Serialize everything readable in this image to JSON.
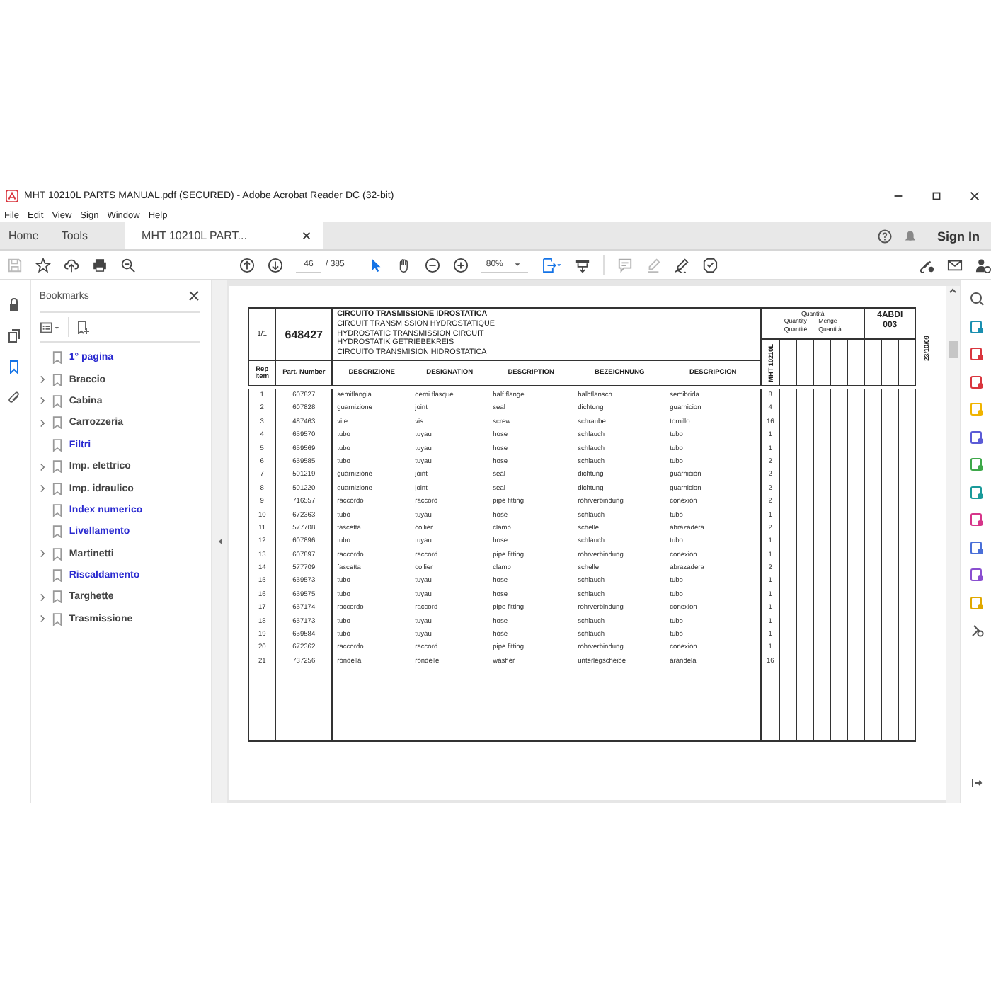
{
  "window": {
    "title": "MHT 10210L PARTS MANUAL.pdf (SECURED) - Adobe Acrobat Reader DC (32-bit)"
  },
  "menu": [
    "File",
    "Edit",
    "View",
    "Sign",
    "Window",
    "Help"
  ],
  "tabs": [
    {
      "label": "Home",
      "selected": false,
      "closable": false
    },
    {
      "label": "Tools",
      "selected": false,
      "closable": false
    },
    {
      "label": "MHT 10210L PART...",
      "selected": true,
      "closable": true
    }
  ],
  "sign_in": "Sign In",
  "toolbar": {
    "page": "46",
    "page_count": "/ 385",
    "zoom": "80%"
  },
  "bookmarks": {
    "title": "Bookmarks",
    "items": [
      {
        "label": "1° pagina",
        "has_children": false
      },
      {
        "label": "Braccio",
        "has_children": true
      },
      {
        "label": "Cabina",
        "has_children": true
      },
      {
        "label": "Carrozzeria",
        "has_children": true
      },
      {
        "label": "Filtri",
        "has_children": false
      },
      {
        "label": "Imp. elettrico",
        "has_children": true
      },
      {
        "label": "Imp. idraulico",
        "has_children": true
      },
      {
        "label": "Index numerico",
        "has_children": false
      },
      {
        "label": "Livellamento",
        "has_children": false
      },
      {
        "label": "Martinetti",
        "has_children": true
      },
      {
        "label": "Riscaldamento",
        "has_children": false
      },
      {
        "label": "Targhette",
        "has_children": true
      },
      {
        "label": "Trasmissione",
        "has_children": true
      }
    ]
  },
  "document": {
    "sheet": "1/1",
    "group_number": "648427",
    "titles": [
      "CIRCUITO TRASMISSIONE IDROSTATICA",
      "CIRCUIT TRANSMISSION HYDROSTATIQUE",
      "HYDROSTATIC TRANSMISSION CIRCUIT",
      "HYDROSTATIK GETRIEBEKREIS",
      "CIRCUITO TRANSMISION HIDROSTATICA"
    ],
    "quantity_header": {
      "title": "Quantità",
      "left": [
        "Quantity",
        "Quantité"
      ],
      "right": [
        "Menge",
        "Quantità"
      ]
    },
    "code": [
      "4ABDI",
      "003"
    ],
    "model": "MHT 10210L",
    "date": "23/10/09",
    "columns": [
      "Rep Item",
      "Part. Number",
      "DESCRIZIONE",
      "DESIGNATION",
      "DESCRIPTION",
      "BEZEICHNUNG",
      "DESCRIPCION"
    ],
    "rows": [
      [
        "1",
        "607827",
        "semiflangia",
        "demi flasque",
        "half flange",
        "halbflansch",
        "semibrida",
        "8"
      ],
      [
        "2",
        "607828",
        "guarnizione",
        "joint",
        "seal",
        "dichtung",
        "guarnicion",
        "4"
      ],
      [
        "3",
        "487463",
        "vite",
        "vis",
        "screw",
        "schraube",
        "tornillo",
        "16"
      ],
      [
        "4",
        "659570",
        "tubo",
        "tuyau",
        "hose",
        "schlauch",
        "tubo",
        "1"
      ],
      [
        "5",
        "659569",
        "tubo",
        "tuyau",
        "hose",
        "schlauch",
        "tubo",
        "1"
      ],
      [
        "6",
        "659585",
        "tubo",
        "tuyau",
        "hose",
        "schlauch",
        "tubo",
        "2"
      ],
      [
        "7",
        "501219",
        "guarnizione",
        "joint",
        "seal",
        "dichtung",
        "guarnicion",
        "2"
      ],
      [
        "8",
        "501220",
        "guarnizione",
        "joint",
        "seal",
        "dichtung",
        "guarnicion",
        "2"
      ],
      [
        "9",
        "716557",
        "raccordo",
        "raccord",
        "pipe fitting",
        "rohrverbindung",
        "conexion",
        "2"
      ],
      [
        "10",
        "672363",
        "tubo",
        "tuyau",
        "hose",
        "schlauch",
        "tubo",
        "1"
      ],
      [
        "11",
        "577708",
        "fascetta",
        "collier",
        "clamp",
        "schelle",
        "abrazadera",
        "2"
      ],
      [
        "12",
        "607896",
        "tubo",
        "tuyau",
        "hose",
        "schlauch",
        "tubo",
        "1"
      ],
      [
        "13",
        "607897",
        "raccordo",
        "raccord",
        "pipe fitting",
        "rohrverbindung",
        "conexion",
        "1"
      ],
      [
        "14",
        "577709",
        "fascetta",
        "collier",
        "clamp",
        "schelle",
        "abrazadera",
        "2"
      ],
      [
        "15",
        "659573",
        "tubo",
        "tuyau",
        "hose",
        "schlauch",
        "tubo",
        "1"
      ],
      [
        "16",
        "659575",
        "tubo",
        "tuyau",
        "hose",
        "schlauch",
        "tubo",
        "1"
      ],
      [
        "17",
        "657174",
        "raccordo",
        "raccord",
        "pipe fitting",
        "rohrverbindung",
        "conexion",
        "1"
      ],
      [
        "18",
        "657173",
        "tubo",
        "tuyau",
        "hose",
        "schlauch",
        "tubo",
        "1"
      ],
      [
        "19",
        "659584",
        "tubo",
        "tuyau",
        "hose",
        "schlauch",
        "tubo",
        "1"
      ],
      [
        "20",
        "672362",
        "raccordo",
        "raccord",
        "pipe fitting",
        "rohrverbindung",
        "conexion",
        "1"
      ],
      [
        "21",
        "737256",
        "rondella",
        "rondelle",
        "washer",
        "unterlegscheibe",
        "arandela",
        "16"
      ]
    ]
  }
}
